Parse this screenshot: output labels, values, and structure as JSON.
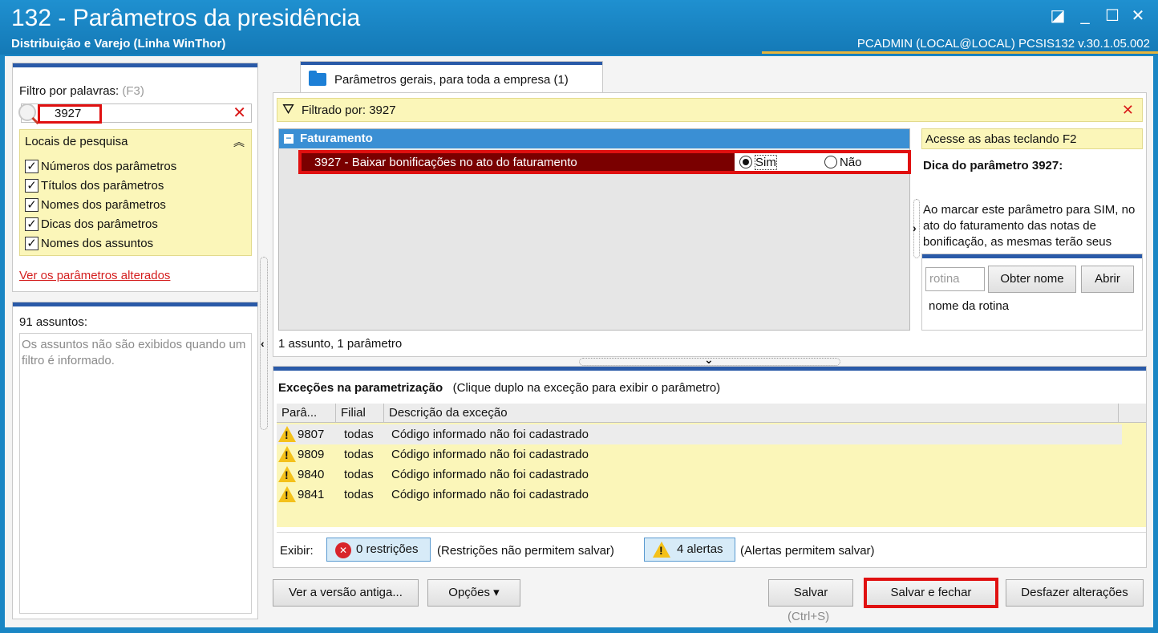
{
  "window": {
    "title": "132 - Parâmetros da presidência",
    "subtitle": "Distribuição e Varejo (Linha WinThor)",
    "user_info": "PCADMIN (LOCAL@LOCAL)   PCSIS132  v.30.1.05.002"
  },
  "filter": {
    "label": "Filtro por palavras:",
    "shortcut": "(F3)",
    "value": "3927",
    "locais_title": "Locais de pesquisa",
    "options": [
      {
        "label": "Números dos parâmetros",
        "checked": true
      },
      {
        "label": "Títulos dos parâmetros",
        "checked": true
      },
      {
        "label": "Nomes dos parâmetros",
        "checked": true
      },
      {
        "label": "Dicas dos parâmetros",
        "checked": true
      },
      {
        "label": "Nomes dos assuntos",
        "checked": true
      }
    ],
    "changed_link": "Ver os parâmetros alterados"
  },
  "assuntos": {
    "count": "91 assuntos:",
    "message": "Os assuntos não são exibidos quando um filtro é informado."
  },
  "tab": {
    "label": "Parâmetros gerais, para toda a empresa  (1)"
  },
  "filtered_by": "Filtrado por: 3927",
  "group": {
    "name": "Faturamento",
    "param": {
      "text": "3927 - Baixar bonificações no ato do faturamento",
      "option_yes": "Sim",
      "option_no": "Não",
      "selected": "Sim"
    }
  },
  "summary": "1 assunto, 1 parâmetro",
  "tips": {
    "hint": "Acesse as abas teclando F2",
    "title": "Dica do parâmetro 3927:",
    "body": "Ao marcar este parâmetro para SIM, no ato do faturamento das notas de bonificação, as mesmas terão seus",
    "rotina_placeholder": "rotina",
    "obter_nome": "Obter nome",
    "abrir": "Abrir",
    "nome_rotina": "nome da rotina"
  },
  "exceptions": {
    "title": "Exceções na parametrização",
    "subtitle": "(Clique duplo na exceção para exibir o parâmetro)",
    "columns": [
      "Parâ...",
      "Filial",
      "Descrição da exceção"
    ],
    "rows": [
      {
        "param": "9807",
        "filial": "todas",
        "desc": "Código informado não foi cadastrado"
      },
      {
        "param": "9809",
        "filial": "todas",
        "desc": "Código informado não foi cadastrado"
      },
      {
        "param": "9840",
        "filial": "todas",
        "desc": "Código informado não foi cadastrado"
      },
      {
        "param": "9841",
        "filial": "todas",
        "desc": "Código informado não foi cadastrado"
      }
    ],
    "exibir": "Exibir:",
    "restricoes_btn": "0 restrições",
    "restricoes_note": "(Restrições não permitem salvar)",
    "alertas_btn": "4 alertas",
    "alertas_note": "(Alertas permitem salvar)"
  },
  "buttons": {
    "versao": "Ver a versão antiga...",
    "opcoes": "Opções ▾",
    "salvar": "Salvar",
    "salvar_hint": "(Ctrl+S)",
    "salvar_fechar": "Salvar e fechar",
    "desfazer": "Desfazer alterações"
  },
  "colors": {
    "titlebar": "#1a86c4",
    "highlight": "#e01010",
    "selected_row": "#7a0000",
    "group_header": "#3a8fd4",
    "note_yellow": "#fbf6b9"
  }
}
